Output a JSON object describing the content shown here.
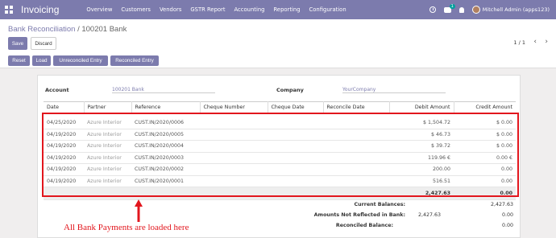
{
  "app": {
    "title": "Invoicing"
  },
  "nav": {
    "menu": [
      "Overview",
      "Customers",
      "Vendors",
      "GSTR Report",
      "Accounting",
      "Reporting",
      "Configuration"
    ],
    "chat_badge": "1",
    "user_name": "Mitchell Admin (apps123)"
  },
  "breadcrumb": {
    "parent": "Bank Reconciliation",
    "separator": "/",
    "current": "100201 Bank"
  },
  "buttons": {
    "save": "Save",
    "discard": "Discard"
  },
  "pager": {
    "value": "1 / 1",
    "prev": "‹",
    "next": "›"
  },
  "actions": {
    "reset": "Reset",
    "load": "Load",
    "unreconciled": "Unreconciled Entry",
    "reconciled": "Reconciled Entry"
  },
  "form": {
    "account_label": "Account",
    "account_value": "100201 Bank",
    "company_label": "Company",
    "company_value": "YourCompany"
  },
  "table": {
    "columns": [
      "Date",
      "Partner",
      "Reference",
      "Cheque Number",
      "Cheque Date",
      "Reconcile Date",
      "Debit Amount",
      "Credit Amount"
    ],
    "rows": [
      {
        "date": "04/25/2020",
        "partner": "Azure Interior",
        "reference": "CUST.IN/2020/0006",
        "debit": "$ 1,504.72",
        "credit": "$ 0.00"
      },
      {
        "date": "04/19/2020",
        "partner": "Azure Interior",
        "reference": "CUST.IN/2020/0005",
        "debit": "$ 46.73",
        "credit": "$ 0.00"
      },
      {
        "date": "04/19/2020",
        "partner": "Azure Interior",
        "reference": "CUST.IN/2020/0004",
        "debit": "$ 39.72",
        "credit": "$ 0.00"
      },
      {
        "date": "04/19/2020",
        "partner": "Azure Interior",
        "reference": "CUST.IN/2020/0003",
        "debit": "119.96 €",
        "credit": "0.00 €"
      },
      {
        "date": "04/19/2020",
        "partner": "Azure Interior",
        "reference": "CUST.IN/2020/0002",
        "debit": "200.00",
        "credit": "0.00"
      },
      {
        "date": "04/19/2020",
        "partner": "Azure Interior",
        "reference": "CUST.IN/2020/0001",
        "debit": "516.51",
        "credit": "0.00"
      }
    ],
    "total_debit": "2,427.63",
    "total_credit": "0.00"
  },
  "summary": {
    "current_label": "Current Balances:",
    "current_value": "2,427.63",
    "not_reflected_label": "Amounts Not Reflected in Bank:",
    "not_reflected_mid": "2,427.63",
    "not_reflected_value": "0.00",
    "reconciled_label": "Reconciled Balance:",
    "reconciled_value": "0.00"
  },
  "annotation": {
    "text": "All Bank Payments are loaded here",
    "color": "#e2161d"
  },
  "colors": {
    "brand": "#7c7bad",
    "highlight": "#e2161d"
  }
}
